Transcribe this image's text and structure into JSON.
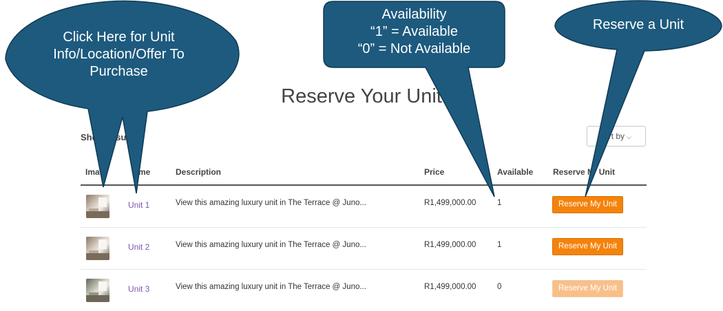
{
  "page": {
    "title": "Reserve Your Unit",
    "results_count": "Sho    results",
    "sort_label": "ort by"
  },
  "table": {
    "headers": {
      "image": "Ima",
      "name": "me",
      "description": "Description",
      "price": "Price",
      "available": "Available",
      "reserve": "Reserve M  Unit"
    },
    "rows": [
      {
        "name": "Unit 1",
        "description": "View this amazing luxury unit in The Terrace @ Juno...",
        "price": "R1,499,000.00",
        "available": "1",
        "button": "Reserve My Unit",
        "enabled": true
      },
      {
        "name": "Unit 2",
        "description": "View this amazing luxury unit in The Terrace @ Juno...",
        "price": "R1,499,000.00",
        "available": "1",
        "button": "Reserve My Unit",
        "enabled": true
      },
      {
        "name": "Unit 3",
        "description": "View this amazing luxury unit in The Terrace @ Juno...",
        "price": "R1,499,000.00",
        "available": "0",
        "button": "Reserve My Unit",
        "enabled": false
      }
    ]
  },
  "callouts": {
    "unit_info": [
      "Click Here for Unit",
      "Info/Location/Offer To",
      "Purchase"
    ],
    "availability": [
      "Availability",
      "“1” = Available",
      "“0” = Not Available"
    ],
    "reserve": "Reserve a Unit"
  },
  "colors": {
    "callout_fill": "#1d5a7e",
    "button": "#f4830c",
    "button_disabled": "#f8c089",
    "link": "#7f54b3"
  }
}
